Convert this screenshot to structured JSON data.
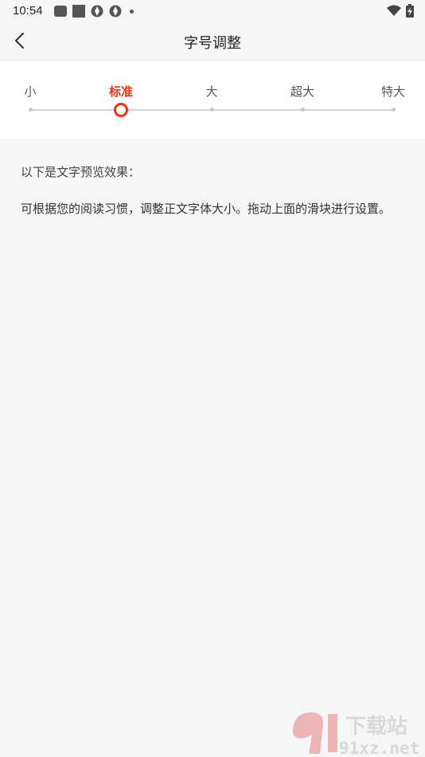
{
  "status_bar": {
    "time": "10:54",
    "left_icons": [
      "app-notification-icon",
      "square-icon",
      "aperture-icon",
      "aperture-icon",
      "dot-icon"
    ],
    "right_icons": [
      "wifi-icon",
      "battery-charging-icon"
    ]
  },
  "header": {
    "title": "字号调整",
    "back_icon": "chevron-left-icon"
  },
  "font_size": {
    "options": [
      "小",
      "标准",
      "大",
      "超大",
      "特大"
    ],
    "selected_index": 1,
    "accent_color": "#e8340f"
  },
  "preview": {
    "heading": "以下是文字预览效果：",
    "text": "可根据您的阅读习惯，调整正文字体大小。拖动上面的滑块进行设置。"
  },
  "watermark": {
    "brand": "下载站",
    "site": "91xz.net"
  }
}
